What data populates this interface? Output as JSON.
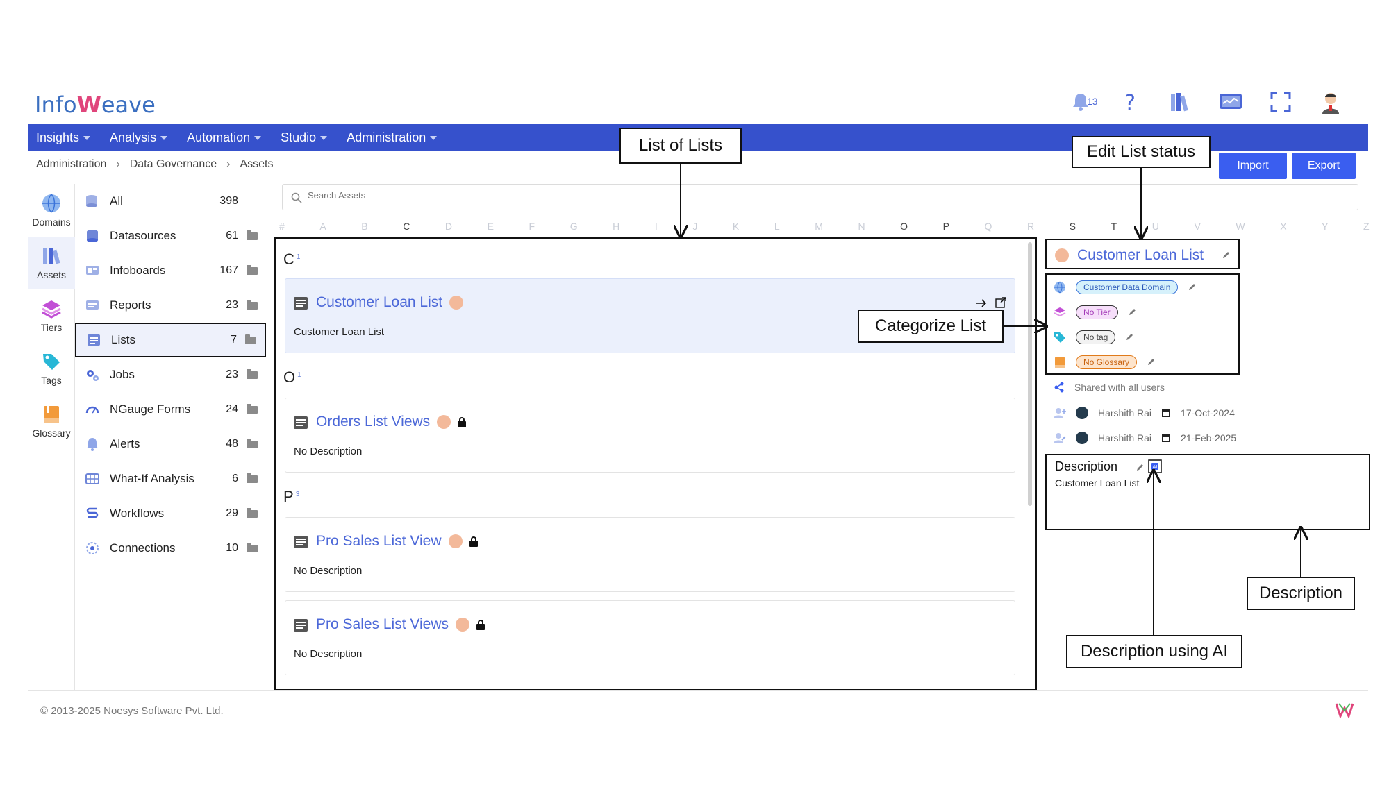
{
  "header": {
    "logo_prefix": "Info",
    "logo_mark": "W",
    "logo_suffix": "eave",
    "notification_count": "13",
    "icons": [
      "bell-icon",
      "help-icon",
      "library-icon",
      "monitor-icon",
      "fullscreen-icon",
      "user-avatar"
    ]
  },
  "nav": {
    "items": [
      {
        "label": "Insights"
      },
      {
        "label": "Analysis"
      },
      {
        "label": "Automation"
      },
      {
        "label": "Studio"
      },
      {
        "label": "Administration"
      }
    ]
  },
  "breadcrumb": [
    "Administration",
    "Data Governance",
    "Assets"
  ],
  "actions": {
    "import": "Import",
    "export": "Export"
  },
  "rail": [
    {
      "label": "Domains",
      "icon": "globe-icon"
    },
    {
      "label": "Assets",
      "icon": "assets-icon"
    },
    {
      "label": "Tiers",
      "icon": "layers-icon"
    },
    {
      "label": "Tags",
      "icon": "tag-icon"
    },
    {
      "label": "Glossary",
      "icon": "book-icon"
    }
  ],
  "categories": [
    {
      "label": "All",
      "count": "398"
    },
    {
      "label": "Datasources",
      "count": "61"
    },
    {
      "label": "Infoboards",
      "count": "167"
    },
    {
      "label": "Reports",
      "count": "23"
    },
    {
      "label": "Lists",
      "count": "7"
    },
    {
      "label": "Jobs",
      "count": "23"
    },
    {
      "label": "NGauge Forms",
      "count": "24"
    },
    {
      "label": "Alerts",
      "count": "48"
    },
    {
      "label": "What-If Analysis",
      "count": "6"
    },
    {
      "label": "Workflows",
      "count": "29"
    },
    {
      "label": "Connections",
      "count": "10"
    }
  ],
  "search": {
    "placeholder": "Search Assets"
  },
  "alphabet": [
    "#",
    "A",
    "B",
    "C",
    "D",
    "E",
    "F",
    "G",
    "H",
    "I",
    "J",
    "K",
    "L",
    "M",
    "N",
    "O",
    "P",
    "Q",
    "R",
    "S",
    "T",
    "U",
    "V",
    "W",
    "X",
    "Y",
    "Z"
  ],
  "alphabet_active": [
    "C",
    "O",
    "P",
    "S",
    "T"
  ],
  "groups": [
    {
      "letter": "C",
      "count": "1"
    },
    {
      "letter": "O",
      "count": "1"
    },
    {
      "letter": "P",
      "count": "3"
    }
  ],
  "lists": [
    {
      "title": "Customer Loan List",
      "desc": "Customer Loan List"
    },
    {
      "title": "Orders List Views",
      "desc": "No Description"
    },
    {
      "title": "Pro Sales List View",
      "desc": "No Description"
    },
    {
      "title": "Pro Sales List Views",
      "desc": "No Description"
    }
  ],
  "detail": {
    "title": "Customer Loan List",
    "domain": "Customer Data Domain",
    "tier": "No Tier",
    "tag": "No tag",
    "glossary": "No Glossary",
    "shared": "Shared with all users",
    "created_by": "Harshith Rai",
    "created_on": "17-Oct-2024",
    "modified_by": "Harshith Rai",
    "modified_on": "21-Feb-2025",
    "description_label": "Description",
    "description": "Customer Loan List"
  },
  "annotations": {
    "list_of_lists": "List of Lists",
    "edit_status": "Edit List status",
    "categorize": "Categorize List",
    "description": "Description",
    "description_ai": "Description using AI"
  },
  "footer": {
    "copyright": "© 2013-2025 Noesys Software Pvt. Ltd."
  },
  "colors": {
    "nav": "#3651cc",
    "accent": "#4c68d8",
    "button": "#3a5ef0",
    "status_dot": "#f3b99a"
  }
}
